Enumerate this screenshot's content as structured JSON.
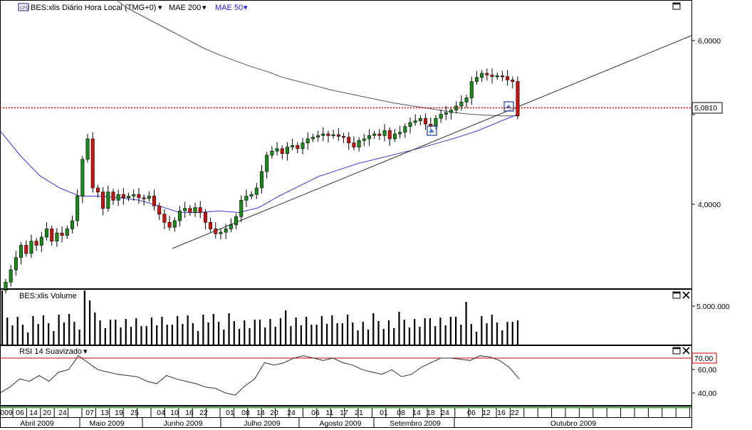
{
  "header": {
    "cfd_badge": "CFD",
    "symbol_label": "BES:xlis Diário Hora Local (TMG+0)",
    "ma200_label": "MAE 200",
    "ma50_label": "MAE 50"
  },
  "volume_panel": {
    "title": "BES:xlis Volume",
    "axis_label": "5.000.000"
  },
  "rsi_panel": {
    "title": "RSI 14 Suavizado",
    "level_label": "70,00",
    "tick_60": "60,00",
    "tick_40": "40,00"
  },
  "price_axis": {
    "ticks": [
      "6,0000",
      "4,0000"
    ],
    "current_price_label": "5,0810"
  },
  "colors": {
    "up": "#1a8a1a",
    "down": "#cc1111",
    "ma50": "#3a3ad6",
    "ma200": "#555555",
    "price_line": "#cc0000",
    "rsi_level": "#cc0000"
  },
  "chart_data": {
    "type": "candlestick",
    "title": "BES:xlis Diário Hora Local (TMG+0)",
    "y_axis_ticks": [
      6.0,
      4.0
    ],
    "ylim": [
      2.6,
      6.5
    ],
    "last_price": 5.081,
    "indicators": [
      "MAE 200",
      "MAE 50",
      "RSI 14 Suavizado",
      "Volume"
    ],
    "rsi_level": 70.0,
    "rsi_ticks": [
      60.0,
      40.0
    ],
    "volume_tick": 5000000,
    "x_day_labels": [
      "009",
      "06",
      "14",
      "20",
      "24",
      "07",
      "13",
      "19",
      "25",
      "04",
      "10",
      "16",
      "22",
      "01",
      "08",
      "14",
      "20",
      "24",
      "06",
      "11",
      "17",
      "21",
      "01",
      "08",
      "14",
      "18",
      "24",
      "06",
      "12",
      "16",
      "22"
    ],
    "x_month_labels": [
      "Abril 2009",
      "Maio 2009",
      "Junho 2009",
      "Julho 2009",
      "Agosto 2009",
      "Setembro 2009",
      "Outubro 2009"
    ],
    "close": [
      3.05,
      3.2,
      3.35,
      3.5,
      3.4,
      3.55,
      3.5,
      3.6,
      3.7,
      3.55,
      3.65,
      3.62,
      3.7,
      3.8,
      4.1,
      4.55,
      4.8,
      4.2,
      4.15,
      3.95,
      4.15,
      4.05,
      4.12,
      4.08,
      4.1,
      4.12,
      4.08,
      4.07,
      4.1,
      3.98,
      3.88,
      3.78,
      3.72,
      3.8,
      3.92,
      3.95,
      3.9,
      3.96,
      3.9,
      3.78,
      3.7,
      3.64,
      3.66,
      3.7,
      3.75,
      3.85,
      4.05,
      4.1,
      4.12,
      4.2,
      4.4,
      4.6,
      4.65,
      4.68,
      4.62,
      4.7,
      4.72,
      4.68,
      4.75,
      4.8,
      4.82,
      4.84,
      4.86,
      4.84,
      4.85,
      4.83,
      4.82,
      4.75,
      4.7,
      4.78,
      4.8,
      4.84,
      4.86,
      4.84,
      4.9,
      4.8,
      4.86,
      4.88,
      4.95,
      5.0,
      5.02,
      5.05,
      4.98,
      4.95,
      5.05,
      5.1,
      5.12,
      5.15,
      5.2,
      5.25,
      5.3,
      5.5,
      5.55,
      5.6,
      5.58,
      5.56,
      5.57,
      5.56,
      5.52,
      5.5,
      5.08
    ],
    "volume_bars": 101,
    "ma200": [
      6.9,
      6.8,
      6.7,
      6.55,
      6.4,
      6.3,
      6.2,
      6.1,
      6.0,
      5.9,
      5.82,
      5.75,
      5.68,
      5.62,
      5.55,
      5.5,
      5.45,
      5.4,
      5.36,
      5.32,
      5.28,
      5.24,
      5.21,
      5.18,
      5.15,
      5.12,
      5.1,
      5.09,
      5.08,
      5.08
    ],
    "ma50": [
      4.9,
      4.6,
      4.35,
      4.2,
      4.1,
      4.1,
      4.08,
      4.05,
      3.98,
      3.9,
      3.9,
      3.92,
      3.9,
      3.96,
      4.1,
      4.22,
      4.34,
      4.42,
      4.5,
      4.56,
      4.62,
      4.68,
      4.75,
      4.82,
      4.9,
      5.0,
      5.1
    ],
    "rsi": [
      40,
      45,
      52,
      50,
      55,
      50,
      58,
      60,
      72,
      66,
      60,
      58,
      56,
      55,
      54,
      50,
      48,
      55,
      52,
      50,
      48,
      45,
      44,
      40,
      38,
      46,
      52,
      66,
      64,
      66,
      70,
      72,
      70,
      68,
      70,
      66,
      64,
      60,
      58,
      56,
      60,
      54,
      56,
      62,
      66,
      70,
      70,
      69,
      68,
      72,
      71,
      68,
      62,
      52
    ],
    "trendlines": [
      "rising support from June 2009 low extended to Oct 2009"
    ]
  }
}
